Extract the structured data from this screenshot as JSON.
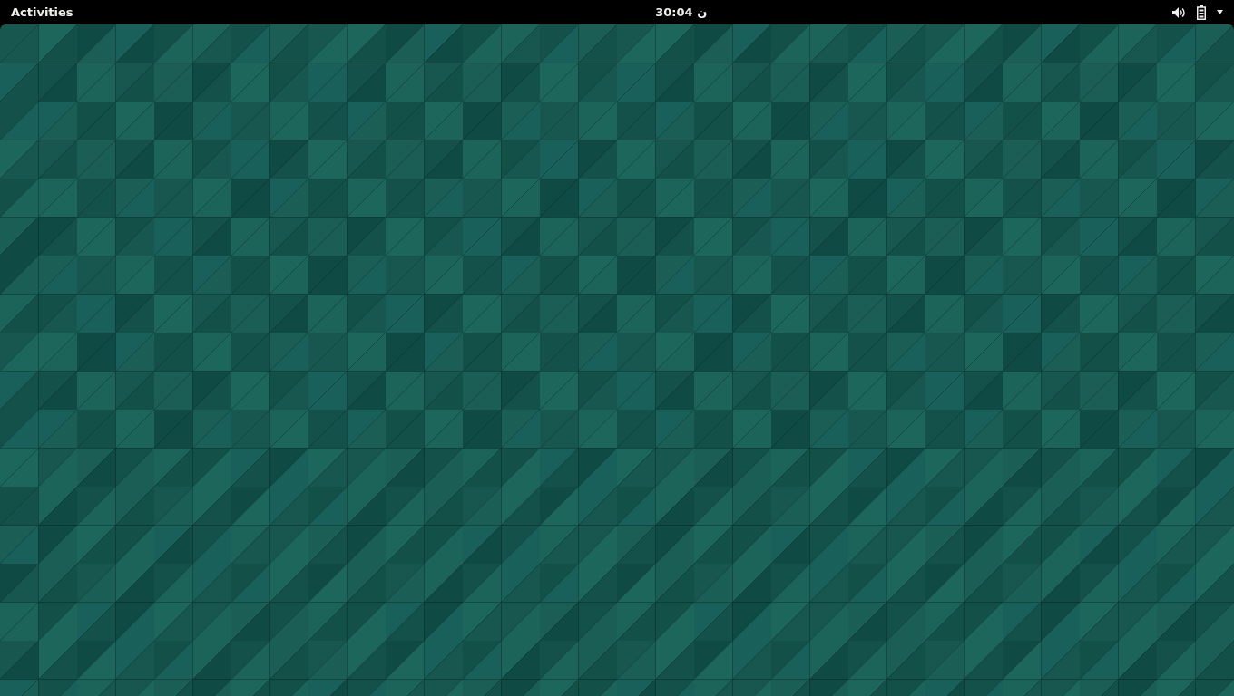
{
  "top_bar": {
    "activities": "Activities",
    "clock": "30:04 ن"
  }
}
